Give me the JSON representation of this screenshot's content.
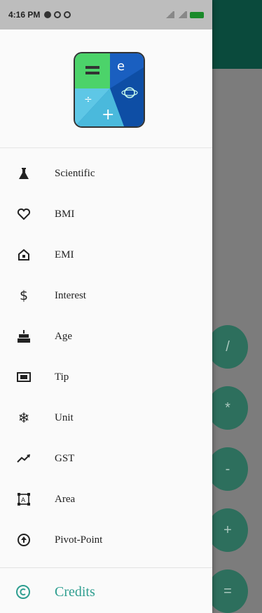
{
  "status_bar": {
    "time": "4:16 PM"
  },
  "app_name_logo": "",
  "menu": {
    "items": [
      {
        "label": "Scientific",
        "icon": "flask-icon"
      },
      {
        "label": "BMI",
        "icon": "heart-icon"
      },
      {
        "label": "EMI",
        "icon": "home-icon"
      },
      {
        "label": "Interest",
        "icon": "dollar-icon"
      },
      {
        "label": "Age",
        "icon": "cake-icon"
      },
      {
        "label": "Tip",
        "icon": "cash-icon"
      },
      {
        "label": "Unit",
        "icon": "snowflake-icon"
      },
      {
        "label": "GST",
        "icon": "trending-up-icon"
      },
      {
        "label": "Area",
        "icon": "area-icon"
      },
      {
        "label": "Pivot-Point",
        "icon": "arrow-circle-icon"
      }
    ]
  },
  "credits": {
    "label": "Credits",
    "icon": "copyright-icon"
  },
  "background_app": {
    "buttons": [
      "/",
      "*",
      "-",
      "+",
      "="
    ]
  },
  "colors": {
    "accent": "#2e9e90",
    "header_dark": "#0a4a3c",
    "fab": "#2d6f5d"
  }
}
